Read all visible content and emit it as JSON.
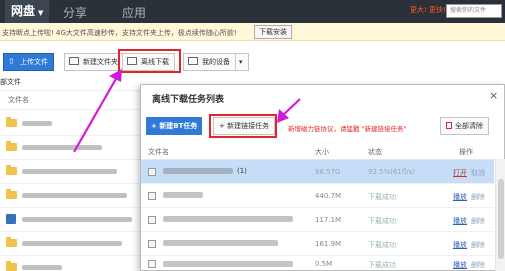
{
  "topbar": {
    "nav": [
      "网盘",
      "分享",
      "应用"
    ],
    "vip_text": "更大! 更快!",
    "search_placeholder": "搜索你的文件"
  },
  "notice": {
    "text": "支持断点上传啦! 4G大文件高速秒传，支持文件夹上传，极点续传随心所欲!",
    "install_label": "下载安装"
  },
  "toolbar": {
    "upload_label": "上传文件",
    "new_folder_label": "新建文件夹",
    "offline_label": "离线下载",
    "device_label": "我的设备"
  },
  "files": {
    "section_label": "部文件",
    "name_header": "文件名"
  },
  "dialog": {
    "title": "离线下载任务列表",
    "close_glyph": "×",
    "bt_label": "新建BT任务",
    "link_label": "+ 新建链接任务",
    "hint": "新增磁力链协议，请猛戳 \"新建链接任务\"",
    "clear_label": "全部清除",
    "columns": {
      "name": "文件名",
      "size": "大小",
      "status": "状态",
      "op": "操作"
    },
    "rows": [
      {
        "name": "(1)",
        "size": "88.57G",
        "status": "92.5%(61fl/s)",
        "op1": "打开",
        "op2": "取消",
        "selected": true
      },
      {
        "name": "",
        "size": "440.7M",
        "status": "下载成功",
        "op1": "播放",
        "op2": "删除",
        "selected": false
      },
      {
        "name": "",
        "size": "117.1M",
        "status": "下载成功",
        "op1": "播放",
        "op2": "删除",
        "selected": false
      },
      {
        "name": "",
        "size": "161.9M",
        "status": "下载成功",
        "op1": "播放",
        "op2": "删除",
        "selected": false
      },
      {
        "name": "",
        "size": "0.5M",
        "status": "下载成功",
        "op1": "播放",
        "op2": "删除",
        "selected": false
      }
    ]
  },
  "colors": {
    "accent": "#2f7ad6",
    "highlight": "#e2242b",
    "arrow": "#d21bd8",
    "topbar": "#2a3138"
  }
}
